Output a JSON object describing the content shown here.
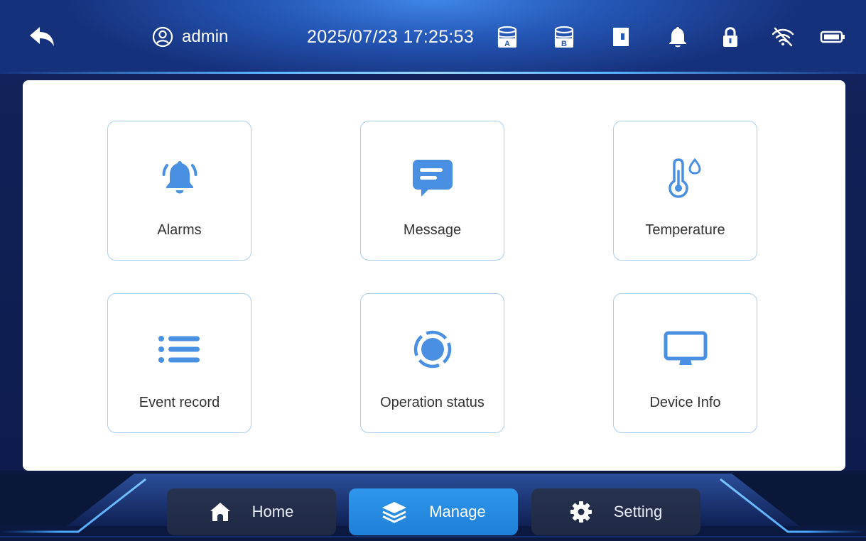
{
  "header": {
    "username": "admin",
    "datetime": "2025/07/23 17:25:53",
    "icons": [
      "back-arrow-icon",
      "user-icon",
      "tank-a-icon",
      "tank-b-icon",
      "door-icon",
      "bell-icon",
      "lock-icon",
      "wifi-off-icon",
      "battery-icon"
    ],
    "tank_a_letter": "A",
    "tank_b_letter": "B"
  },
  "tiles": [
    {
      "label": "Alarms",
      "icon": "bell-ringing-icon"
    },
    {
      "label": "Message",
      "icon": "message-icon"
    },
    {
      "label": "Temperature",
      "icon": "thermometer-icon"
    },
    {
      "label": "Event record",
      "icon": "list-icon"
    },
    {
      "label": "Operation status",
      "icon": "status-ring-icon"
    },
    {
      "label": "Device Info",
      "icon": "monitor-icon"
    }
  ],
  "nav": {
    "items": [
      {
        "label": "Home",
        "icon": "home-icon",
        "active": false
      },
      {
        "label": "Manage",
        "icon": "layers-icon",
        "active": true
      },
      {
        "label": "Setting",
        "icon": "gear-icon",
        "active": false
      }
    ]
  },
  "colors": {
    "accent": "#4a90e2",
    "active_nav": "#2a8fe6",
    "header": "#2558b8",
    "background": "#0d1c4c"
  }
}
